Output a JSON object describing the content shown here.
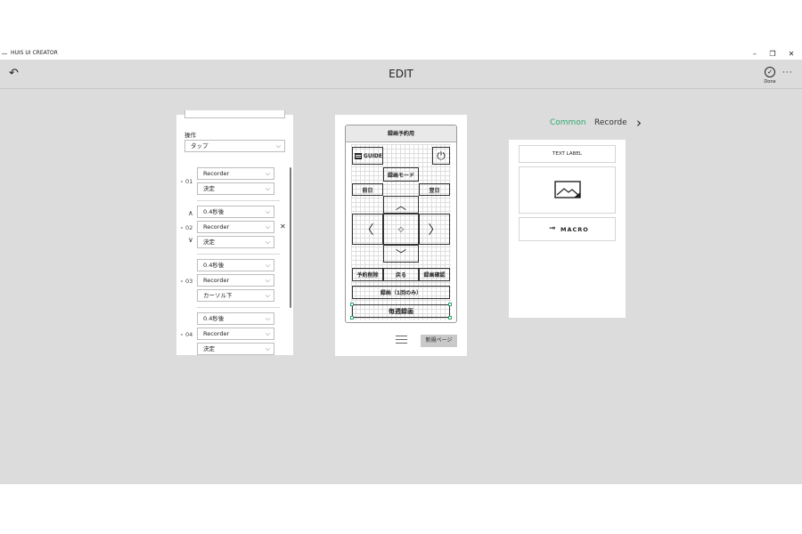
{
  "window": {
    "app_title": "HUIS UI CREATOR",
    "minimize": "–",
    "maximize": "❐",
    "close": "✕"
  },
  "header": {
    "title": "EDIT",
    "back_icon": "↶",
    "done_icon": "✓",
    "done_label": "Done",
    "more_icon": "···"
  },
  "left_panel": {
    "action_label": "操作",
    "action_value": "タップ",
    "chevron": "⌵",
    "rows": [
      {
        "num": "01",
        "fields": [
          "Recorder",
          "決定"
        ]
      },
      {
        "num": "02",
        "fields": [
          "0.4秒後",
          "Recorder",
          "決定"
        ]
      },
      {
        "num": "03",
        "fields": [
          "0.4秒後",
          "Recorder",
          "カーソル下"
        ]
      },
      {
        "num": "04",
        "fields": [
          "0.4秒後",
          "Recorder",
          "決定"
        ]
      }
    ],
    "move_up_icon": "∧",
    "move_down_icon": "∨",
    "delete_icon": "✕"
  },
  "remote": {
    "header": "録画予約用",
    "guide_label": "GUIDE",
    "power_icon": "⏻",
    "record_mode": "録画モード",
    "prev_day": "前日",
    "next_day": "翌日",
    "up_icon": "︿",
    "down_icon": "﹀",
    "left_icon": "〈",
    "right_icon": "〉",
    "center_icon": "◇",
    "cancel_reservation": "予約削除",
    "back": "戻る",
    "confirm_recording": "録画確認",
    "record_once": "録画（1回のみ）",
    "weekly_record": "毎週録画"
  },
  "mid_footer": {
    "new_page": "新規ページ"
  },
  "right_panel": {
    "tabs": [
      "Common",
      "Recorder"
    ],
    "next_icon": "›",
    "active_color": "#2ea86e",
    "items": {
      "text_label": "TEXT LABEL",
      "image_icon": "image-icon",
      "macro_icon": "⊸",
      "macro_label": "MACRO"
    }
  }
}
